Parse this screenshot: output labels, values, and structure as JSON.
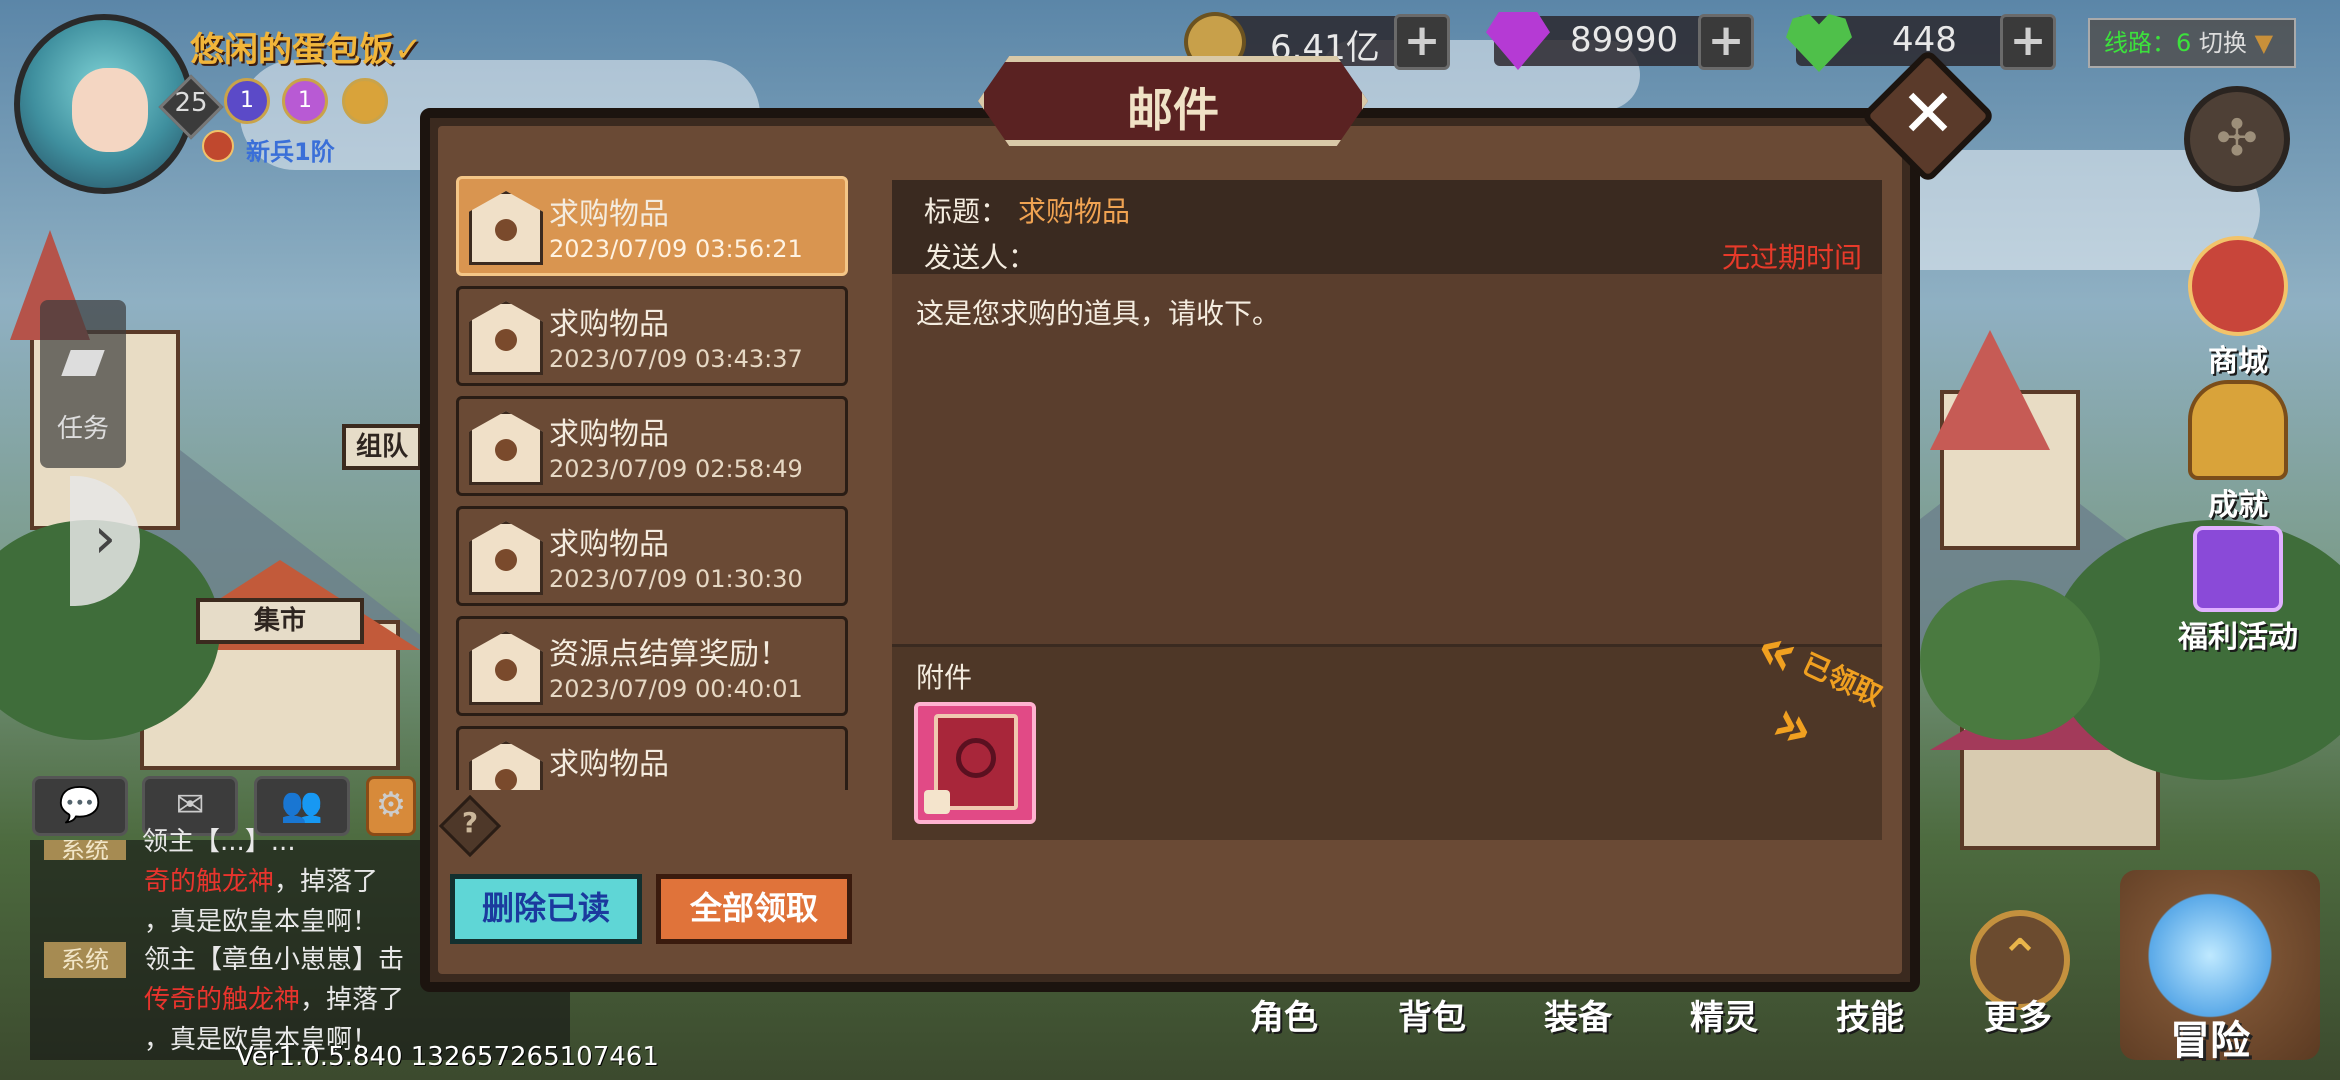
{
  "player": {
    "name": "悠闲的蛋包饭✓",
    "level": "25",
    "medals": [
      "1",
      "1"
    ],
    "rank": "新兵1阶"
  },
  "resources": {
    "gold": "6.41亿",
    "gems": "89990",
    "stamina": "448"
  },
  "server": {
    "line_label": "线路：",
    "line_number": "6",
    "switch_label": "切换"
  },
  "left": {
    "task_label": "任务",
    "team_sign": "组队",
    "market_sign": "集市"
  },
  "chat": {
    "lines": [
      {
        "tag": "系统",
        "text": "领主【...】..."
      },
      {
        "text_red": "奇的触龙神",
        "text": "，掉落了"
      },
      {
        "text": "，真是欧皇本皇啊！"
      },
      {
        "tag": "系统",
        "text": "领主【章鱼小崽崽】击"
      },
      {
        "text_red": "传奇的触龙神",
        "text": "，掉落了"
      },
      {
        "text": "，真是欧皇本皇啊！"
      }
    ]
  },
  "version": "Ver1.0.5.840 132657265107461",
  "right_menu": {
    "shop": "商城",
    "achievement": "成就",
    "welfare": "福利活动"
  },
  "bottom_nav": {
    "role": "角色",
    "bag": "背包",
    "equipment": "装备",
    "spirit": "精灵",
    "skill": "技能",
    "more": "更多",
    "adventure": "冒险"
  },
  "mail_dialog": {
    "title": "邮件",
    "mails": [
      {
        "subject": "求购物品",
        "date": "2023/07/09 03:56:21"
      },
      {
        "subject": "求购物品",
        "date": "2023/07/09 03:43:37"
      },
      {
        "subject": "求购物品",
        "date": "2023/07/09 02:58:49"
      },
      {
        "subject": "求购物品",
        "date": "2023/07/09 01:30:30"
      },
      {
        "subject": "资源点结算奖励！",
        "date": "2023/07/09 00:40:01"
      },
      {
        "subject": "求购物品",
        "date": ""
      }
    ],
    "detail": {
      "title_label": "标题：",
      "title_value": "求购物品",
      "sender_label": "发送人：",
      "expiry": "无过期时间",
      "body": "这是您求购的道具，请收下。",
      "attachment_label": "附件",
      "claimed_stamp": "已领取"
    },
    "buttons": {
      "delete_read": "删除已读",
      "claim_all": "全部领取"
    },
    "help": "?"
  }
}
